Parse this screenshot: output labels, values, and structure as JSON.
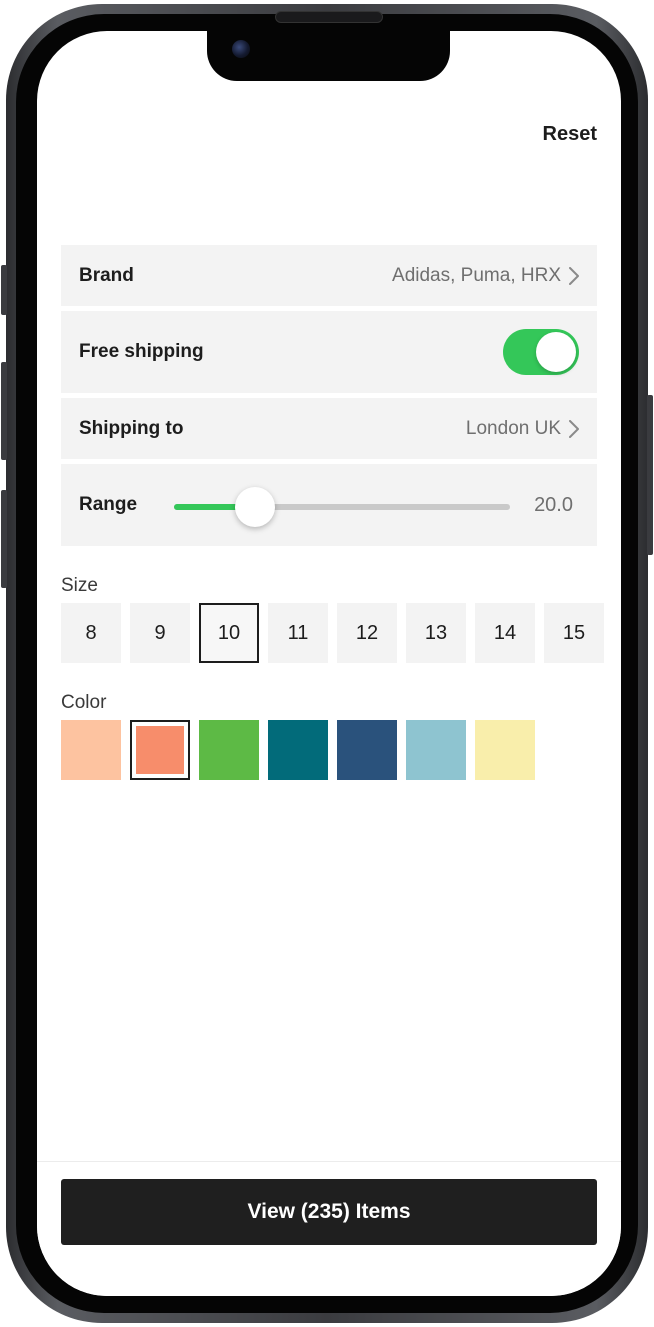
{
  "header": {
    "reset_label": "Reset"
  },
  "filters": {
    "brand": {
      "label": "Brand",
      "value": "Adidas, Puma, HRX"
    },
    "free_shipping": {
      "label": "Free shipping",
      "enabled": true
    },
    "shipping_to": {
      "label": "Shipping to",
      "value": "London UK"
    },
    "range": {
      "label": "Range",
      "value_text": "20.0",
      "fill_fraction": 0.24
    }
  },
  "size": {
    "title": "Size",
    "options": [
      "8",
      "9",
      "10",
      "11",
      "12",
      "13",
      "14",
      "15"
    ],
    "selected": "10"
  },
  "color": {
    "title": "Color",
    "swatches": [
      "#fdc3a0",
      "#f78d6b",
      "#5dba45",
      "#026b7a",
      "#2a527c",
      "#8ec4d0",
      "#f9eeab"
    ],
    "selected_index": 1
  },
  "footer": {
    "cta_label": "View (235) Items"
  },
  "theme": {
    "accent": "#34c759",
    "cta_bg": "#1f1f1f"
  }
}
